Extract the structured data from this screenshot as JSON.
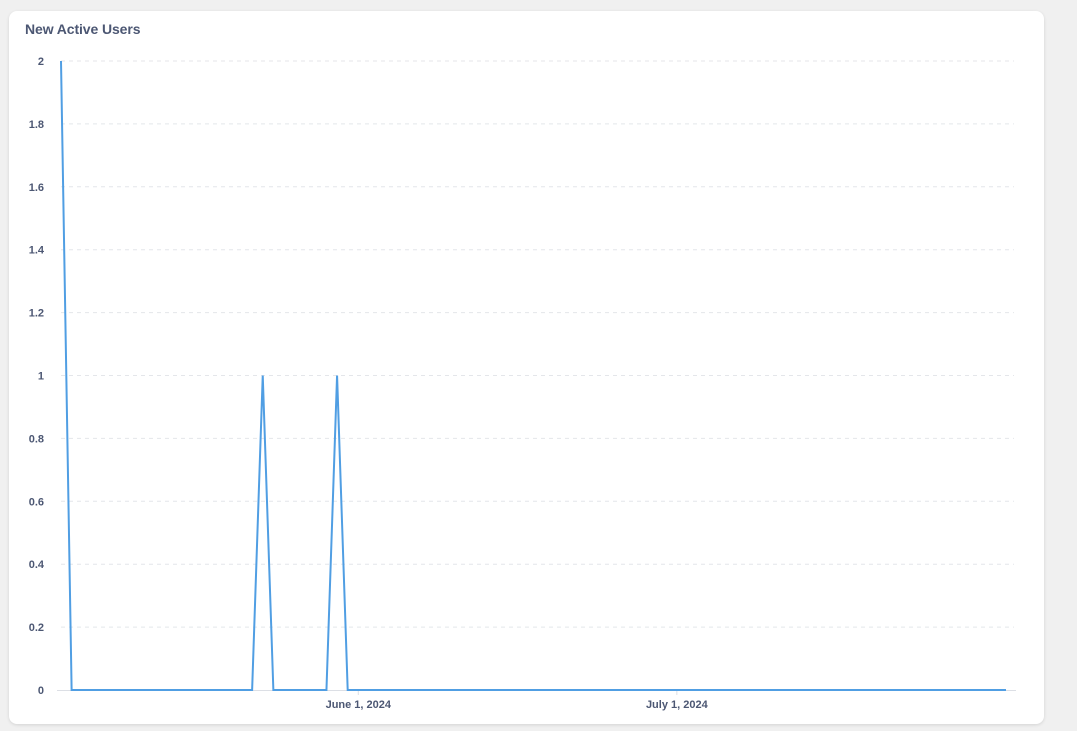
{
  "card": {
    "title": "New Active Users"
  },
  "colors": {
    "series": "#509ee3",
    "grid": "#e4e6ea",
    "axis": "#dcdfe5",
    "label": "#4c5773"
  },
  "chart_data": {
    "type": "line",
    "title": "New Active Users",
    "xlabel": "",
    "ylabel": "",
    "ylim": [
      0,
      2
    ],
    "yticks": [
      0,
      0.2,
      0.4,
      0.6,
      0.8,
      1,
      1.2,
      1.4,
      1.6,
      1.8,
      2
    ],
    "xlim": [
      "2024-05-04",
      "2024-08-01"
    ],
    "xticks": [
      {
        "date": "2024-06-01",
        "label": "June 1, 2024"
      },
      {
        "date": "2024-07-01",
        "label": "July 1, 2024"
      }
    ],
    "grid": true,
    "legend": "none",
    "series": [
      {
        "name": "",
        "points": [
          {
            "x": "2024-05-04",
            "y": 2
          },
          {
            "x": "2024-05-05",
            "y": 0
          },
          {
            "x": "2024-05-22",
            "y": 0
          },
          {
            "x": "2024-05-23",
            "y": 1
          },
          {
            "x": "2024-05-24",
            "y": 0
          },
          {
            "x": "2024-05-29",
            "y": 0
          },
          {
            "x": "2024-05-30",
            "y": 1
          },
          {
            "x": "2024-05-31",
            "y": 0
          },
          {
            "x": "2024-08-01",
            "y": 0
          }
        ]
      }
    ]
  }
}
